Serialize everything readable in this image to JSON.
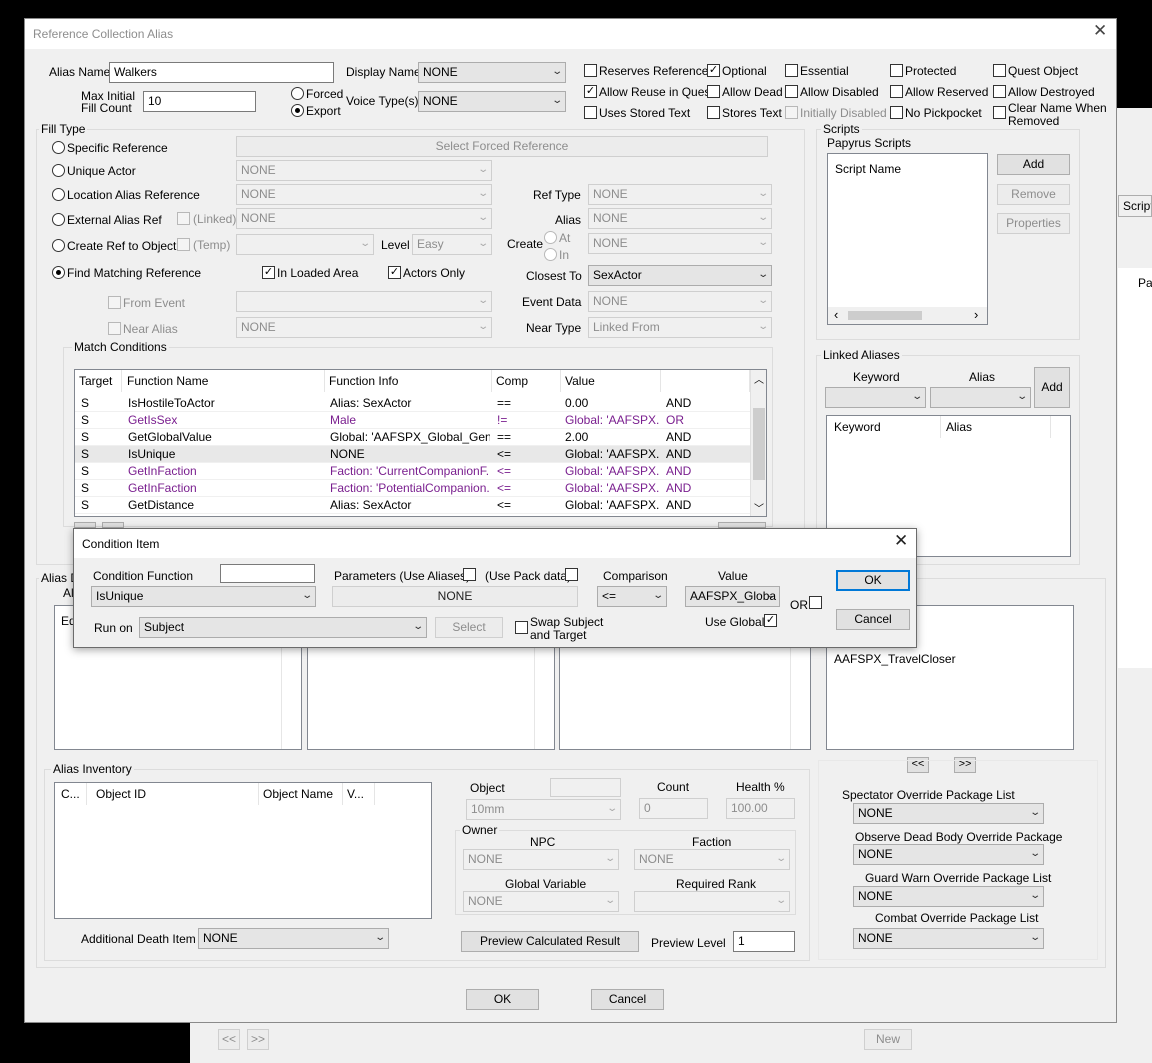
{
  "bg_window": {
    "scripts_tab": "Script",
    "pa_text": "Pa",
    "new_btn": "New",
    "nav_prev": "<<",
    "nav_next": ">>"
  },
  "main": {
    "title": "Reference Collection Alias",
    "close_icon": "close-icon",
    "alias_name_label": "Alias Name",
    "alias_name_value": "Walkers",
    "max_initial_label1": "Max Initial",
    "max_initial_label2": "Fill Count",
    "max_initial_value": "10",
    "forced_label": "Forced",
    "export_label": "Export",
    "display_name_label": "Display Name",
    "display_name_value": "NONE",
    "voice_label": "Voice Type(s)",
    "voice_value": "NONE",
    "flags": {
      "reserves_reference": "Reserves Reference",
      "optional": "Optional",
      "essential": "Essential",
      "protected": "Protected",
      "quest_object": "Quest Object",
      "allow_reuse": "Allow Reuse in Quest",
      "allow_dead": "Allow Dead",
      "allow_disabled": "Allow Disabled",
      "allow_reserved": "Allow Reserved",
      "allow_destroyed": "Allow Destroyed",
      "uses_stored_text": "Uses Stored Text",
      "stores_text": "Stores Text",
      "initially_disabled": "Initially Disabled",
      "no_pickpocket": "No Pickpocket",
      "clear_name1": "Clear Name When",
      "clear_name2": "Removed"
    },
    "fill_type": {
      "title": "Fill Type",
      "specific_reference": "Specific Reference",
      "select_forced_reference": "Select Forced Reference",
      "unique_actor": "Unique Actor",
      "unique_actor_value": "NONE",
      "location_alias_reference": "Location Alias Reference",
      "location_alias_value": "NONE",
      "external_alias_ref": "External Alias Ref",
      "linked": "(Linked)",
      "external_value": "NONE",
      "create_ref_to_object": "Create Ref to Object",
      "temp": "(Temp)",
      "level_label": "Level",
      "level_value": "Easy",
      "find_matching_reference": "Find Matching Reference",
      "in_loaded_area": "In Loaded Area",
      "actors_only": "Actors Only",
      "from_event": "From Event",
      "near_alias": "Near Alias",
      "near_alias_value": "NONE",
      "ref_type_label": "Ref Type",
      "ref_type_value": "NONE",
      "alias_label": "Alias",
      "alias_value": "NONE",
      "create_label": "Create",
      "at_label": "At",
      "in_label": "In",
      "create_value": "NONE",
      "closest_to_label": "Closest To",
      "closest_to_value": "SexActor",
      "event_data_label": "Event Data",
      "event_data_value": "NONE",
      "near_type_label": "Near Type",
      "near_type_value": "Linked From"
    },
    "match_conditions": {
      "title": "Match Conditions",
      "columns": [
        "Target",
        "Function Name",
        "Function Info",
        "Comp",
        "Value",
        ""
      ],
      "rows": [
        {
          "target": "S",
          "fn": "IsHostileToActor",
          "info": "Alias: SexActor",
          "comp": "==",
          "value": "0.00",
          "op": "AND",
          "style": "normal"
        },
        {
          "target": "S",
          "fn": "GetIsSex",
          "info": "Male",
          "comp": "!=",
          "value": "Global: 'AAFSPX...",
          "op": "OR",
          "style": "purple"
        },
        {
          "target": "S",
          "fn": "GetGlobalValue",
          "info": "Global: 'AAFSPX_Global_Gender'",
          "comp": "==",
          "value": "2.00",
          "op": "AND",
          "style": "normal"
        },
        {
          "target": "S",
          "fn": "IsUnique",
          "info": "NONE",
          "comp": "<=",
          "value": "Global: 'AAFSPX...",
          "op": "AND",
          "style": "selected"
        },
        {
          "target": "S",
          "fn": "GetInFaction",
          "info": "Faction: 'CurrentCompanionF...",
          "comp": "<=",
          "value": "Global: 'AAFSPX...",
          "op": "AND",
          "style": "purple"
        },
        {
          "target": "S",
          "fn": "GetInFaction",
          "info": "Faction: 'PotentialCompanion...",
          "comp": "<=",
          "value": "Global: 'AAFSPX...",
          "op": "AND",
          "style": "purple"
        },
        {
          "target": "S",
          "fn": "GetDistance",
          "info": "Alias: SexActor",
          "comp": "<=",
          "value": "Global: 'AAFSPX...",
          "op": "AND",
          "style": "normal"
        }
      ]
    },
    "scripts": {
      "title": "Scripts",
      "subtitle": "Papyrus Scripts",
      "column": "Script Name",
      "add": "Add",
      "remove": "Remove",
      "properties": "Properties"
    },
    "linked_aliases": {
      "title": "Linked Aliases",
      "keyword_label": "Keyword",
      "alias_label": "Alias",
      "add": "Add",
      "col_keyword": "Keyword",
      "col_alias": "Alias"
    },
    "lower_lists": {
      "alias_d_partial": "Alias D",
      "ali_partial": "Ali",
      "ed_partial": "Ed",
      "travel_closer": "AAFSPX_TravelCloser",
      "prev": "<<",
      "next": ">>"
    },
    "inventory": {
      "title": "Alias Inventory",
      "columns": [
        "C...",
        "Object ID",
        "Object Name",
        "V..."
      ],
      "object_label": "Object",
      "object_value": "10mm",
      "count_label": "Count",
      "count_value": "0",
      "health_label": "Health %",
      "health_value": "100.00",
      "owner_label": "Owner",
      "npc_label": "NPC",
      "npc_value": "NONE",
      "faction_label": "Faction",
      "faction_value": "NONE",
      "global_var_label": "Global Variable",
      "global_var_value": "NONE",
      "required_rank_label": "Required Rank",
      "additional_death_label": "Additional Death Item",
      "additional_death_value": "NONE",
      "preview_btn": "Preview Calculated Result",
      "preview_level_label": "Preview Level",
      "preview_level_value": "1"
    },
    "packages": {
      "spectator": "Spectator Override Package List",
      "spectator_value": "NONE",
      "observe": "Observe Dead Body Override Package",
      "observe_value": "NONE",
      "guard": "Guard Warn Override Package List",
      "guard_value": "NONE",
      "combat": "Combat Override Package List",
      "combat_value": "NONE"
    },
    "ok": "OK",
    "cancel": "Cancel"
  },
  "condition_item": {
    "title": "Condition Item",
    "condition_function_label": "Condition Function",
    "condition_function_value": "IsUnique",
    "parameters_label": "Parameters  (Use Aliases)",
    "use_pack_data": "(Use Pack data)",
    "parameters_value": "NONE",
    "comparison_label": "Comparison",
    "comparison_value": "<=",
    "value_label": "Value",
    "value_value": "AAFSPX_Globa",
    "or_label": "OR",
    "use_global": "Use Global",
    "run_on_label": "Run on",
    "run_on_value": "Subject",
    "select": "Select",
    "swap1": "Swap Subject",
    "swap2": "and Target",
    "ok": "OK",
    "cancel": "Cancel"
  }
}
